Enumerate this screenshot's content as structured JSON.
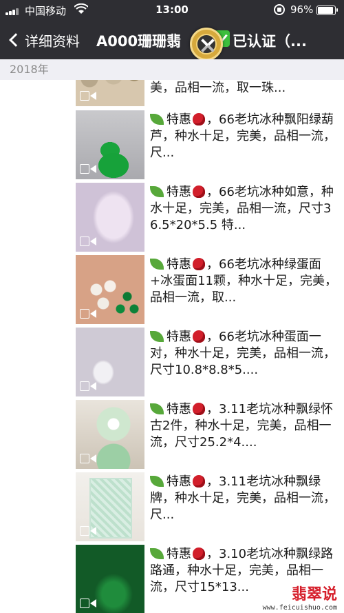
{
  "status_bar": {
    "carrier": "中国移动",
    "time": "13:00",
    "battery": "96%"
  },
  "nav": {
    "back_label": "详细资料",
    "title": "A000珊珊翡",
    "title_suffix": "已认证（..."
  },
  "section": {
    "year": "2018年"
  },
  "items": [
    {
      "text": "美，品相一流，取一珠..."
    },
    {
      "text": "特惠，66老坑冰种飘阳绿葫芦，种水十足，完美，品相一流，尺..."
    },
    {
      "text": "特惠，66老坑冰种如意，种水十足，完美，品相一流，尺寸36.5*20*5.5 特..."
    },
    {
      "text": "特惠，66老坑冰种绿蛋面+冰蛋面11颗，种水十足，完美，品相一流，取..."
    },
    {
      "text": "特惠，66老坑冰种蛋面一对，种水十足，完美，品相一流，尺寸10.8*8.8*5...."
    },
    {
      "text": "特惠，3.11老坑冰种飘绿怀古2件，种水十足，完美，品相一流，尺寸25.2*4...."
    },
    {
      "text": "特惠，3.11老坑冰种飘绿牌，种水十足，完美，品相一流，尺..."
    },
    {
      "text": "特惠，3.10老坑冰种飘绿路路通，种水十足，完美，品相一流，尺寸15*13..."
    }
  ],
  "watermark": {
    "title": "翡翠说",
    "url": "www.feicuishuo.com"
  }
}
